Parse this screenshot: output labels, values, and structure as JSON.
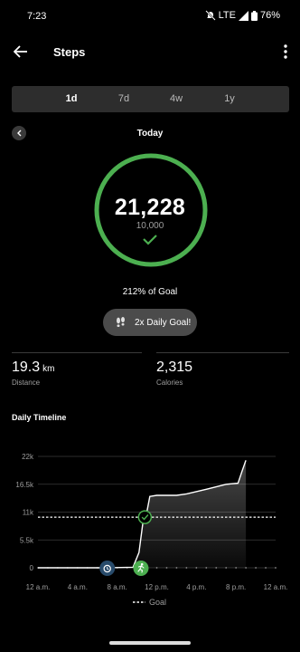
{
  "status_bar": {
    "time": "7:23",
    "network": "LTE",
    "battery": "76%"
  },
  "app_bar": {
    "title": "Steps"
  },
  "range_tabs": [
    {
      "label": "1d",
      "active": true
    },
    {
      "label": "7d",
      "active": false
    },
    {
      "label": "4w",
      "active": false
    },
    {
      "label": "1y",
      "active": false
    }
  ],
  "day_nav": {
    "label": "Today"
  },
  "summary": {
    "steps": "21,228",
    "goal": "10,000",
    "percent_of_goal": "212% of Goal",
    "progress_fraction": 1.0,
    "badge_label": "2x Daily Goal!"
  },
  "stats": {
    "distance_value": "19.3",
    "distance_unit": "km",
    "distance_label": "Distance",
    "calories_value": "2,315",
    "calories_label": "Calories"
  },
  "timeline": {
    "title": "Daily Timeline"
  },
  "colors": {
    "accent_green": "#4caf50",
    "tab_bar_bg": "#2d2d2d",
    "badge_bg": "#4b4b4b"
  },
  "chart_data": {
    "type": "area",
    "title": "Daily Timeline",
    "xlabel": "",
    "ylabel": "",
    "x_tick_labels": [
      "12 a.m.",
      "4 a.m.",
      "8 a.m.",
      "12 p.m.",
      "4 p.m.",
      "8 p.m.",
      "12 a.m."
    ],
    "x_range_hours": [
      0,
      24
    ],
    "y_tick_labels": [
      "22k",
      "16.5k",
      "11k",
      "5.5k",
      "0"
    ],
    "y_tick_values": [
      22000,
      16500,
      11000,
      5500,
      0
    ],
    "ylim": [
      0,
      22000
    ],
    "goal_value": 10000,
    "legend": [
      {
        "name": "Goal",
        "style": "dashed"
      }
    ],
    "series": [
      {
        "name": "Steps",
        "points": [
          [
            0,
            0
          ],
          [
            7,
            0
          ],
          [
            9.6,
            100
          ],
          [
            10.2,
            3000
          ],
          [
            10.6,
            9000
          ],
          [
            11,
            11000
          ],
          [
            11.3,
            14100
          ],
          [
            12,
            14300
          ],
          [
            14,
            14300
          ],
          [
            15,
            14600
          ],
          [
            17,
            15500
          ],
          [
            19,
            16500
          ],
          [
            20.2,
            16700
          ],
          [
            20.6,
            19000
          ],
          [
            21,
            21228
          ]
        ]
      }
    ],
    "markers": [
      {
        "name": "sleep-alarm",
        "x_hours": 7.0,
        "y": 0
      },
      {
        "name": "activity-run",
        "x_hours": 10.4,
        "y": 0
      },
      {
        "name": "goal-reached",
        "x_hours": 10.8,
        "y": 10000
      }
    ],
    "grid": "horizontal"
  }
}
